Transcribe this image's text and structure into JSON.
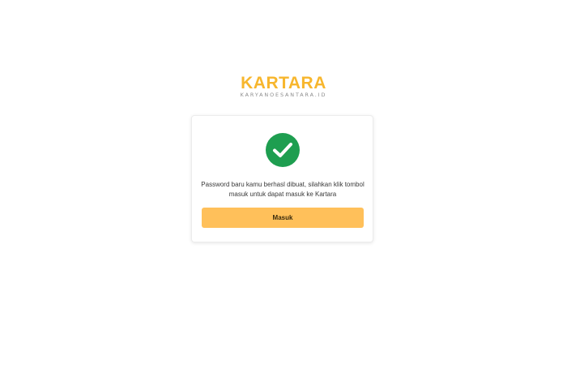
{
  "brand": {
    "name": "KARTARA",
    "tagline": "KARYANOESANTARA.ID",
    "color": "#f7b62d"
  },
  "card": {
    "status_icon": "check-circle-icon",
    "status_color": "#1e9e50",
    "message": "Password baru kamu berhasl dibuat, silahkan klik tombol masuk untuk dapat masuk ke Kartara",
    "button_label": "Masuk",
    "button_color": "#ffc05a"
  }
}
